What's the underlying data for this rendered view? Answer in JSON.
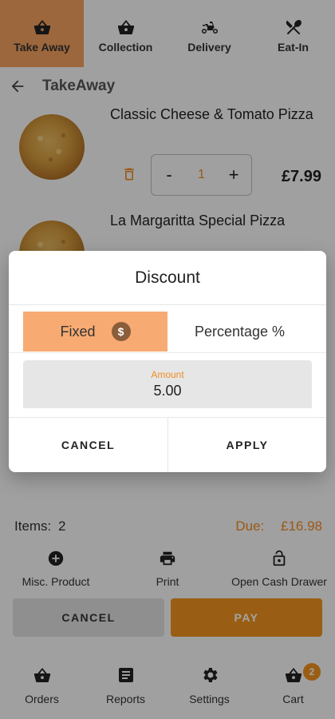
{
  "top_tabs": [
    {
      "label": "Take Away",
      "icon": "basket-icon",
      "active": true
    },
    {
      "label": "Collection",
      "icon": "basket-icon"
    },
    {
      "label": "Delivery",
      "icon": "scooter-icon"
    },
    {
      "label": "Eat-In",
      "icon": "cutlery-icon"
    }
  ],
  "header": {
    "title": "TakeAway"
  },
  "items": [
    {
      "name": "Classic Cheese & Tomato Pizza",
      "quantity": "1",
      "minus": "-",
      "plus": "+",
      "price": "£7.99"
    },
    {
      "name": "La Margaritta Special Pizza"
    }
  ],
  "summary": {
    "items_label": "Items:",
    "items_count": "2",
    "due_label": "Due:",
    "due_amount": "£16.98"
  },
  "actions": [
    {
      "label": "Misc. Product",
      "icon": "add-circle-icon"
    },
    {
      "label": "Print",
      "icon": "printer-icon"
    },
    {
      "label": "Open Cash Drawer",
      "icon": "lock-icon"
    }
  ],
  "buttons": {
    "cancel": "CANCEL",
    "pay": "PAY"
  },
  "bottom_nav": [
    {
      "label": "Orders",
      "icon": "basket-icon"
    },
    {
      "label": "Reports",
      "icon": "document-icon"
    },
    {
      "label": "Settings",
      "icon": "gear-icon"
    },
    {
      "label": "Cart",
      "icon": "cart-icon",
      "badge": "2"
    }
  ],
  "dialog": {
    "title": "Discount",
    "options": [
      {
        "label": "Fixed",
        "icon": "dollar-icon",
        "symbol": "$",
        "selected": true
      },
      {
        "label": "Percentage %"
      }
    ],
    "amount_label": "Amount",
    "amount_value": "5.00",
    "cancel": "CANCEL",
    "apply": "APPLY"
  },
  "colors": {
    "accent": "#f0931e",
    "accent_light": "#f7aa72",
    "tab_active": "#f5a15e"
  }
}
